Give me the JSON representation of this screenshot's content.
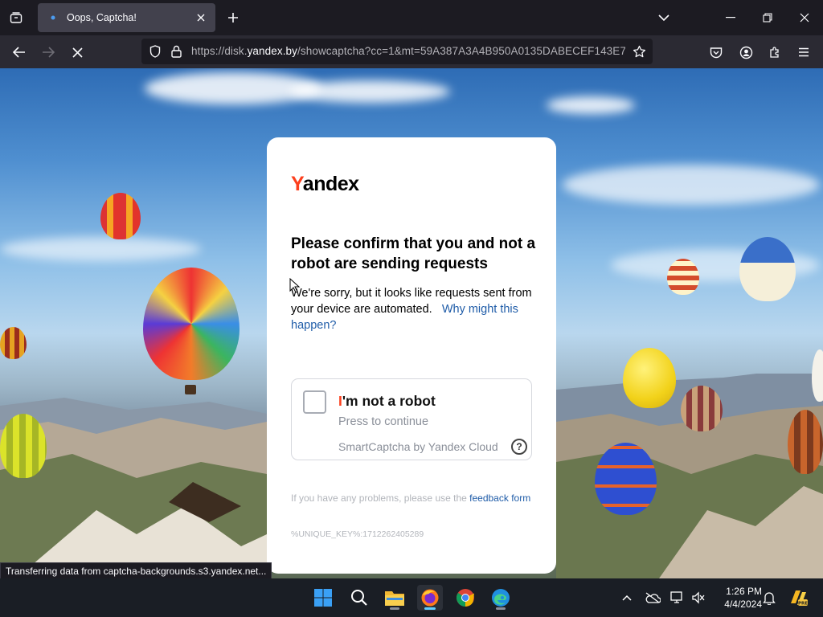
{
  "browser": {
    "tab": {
      "title": "Oops, Captcha!"
    },
    "url": {
      "prefix": "https://disk.",
      "domain": "yandex.by",
      "suffix": "/showcaptcha?cc=1&mt=59A387A3A4B950A0135DABECEF143E7"
    },
    "status_text": "Transferring data from captcha-backgrounds.s3.yandex.net..."
  },
  "page": {
    "logo": {
      "first": "Y",
      "rest": "andex"
    },
    "heading": "Please confirm that you and not a robot are sending requests",
    "description": "We're sorry, but it looks like requests sent from your device are automated.",
    "why_link": "Why might this happen?",
    "captcha": {
      "title_first": "I",
      "title_rest": "'m not a robot",
      "subtitle": "Press to continue",
      "brand": "SmartCaptcha by Yandex Cloud",
      "help_symbol": "?"
    },
    "feedback_text": "If you have any problems, please use the",
    "feedback_link": "feedback form",
    "unique_key": "%UNIQUE_KEY%:1712262405289"
  },
  "taskbar": {
    "time": "1:26 PM",
    "date": "4/4/2024",
    "apps": [
      "start",
      "search",
      "file-explorer",
      "firefox",
      "chrome",
      "edge"
    ],
    "active_app": "firefox"
  },
  "colors": {
    "yandex_red": "#fc3f1d",
    "link_blue": "#1f5ca8"
  }
}
